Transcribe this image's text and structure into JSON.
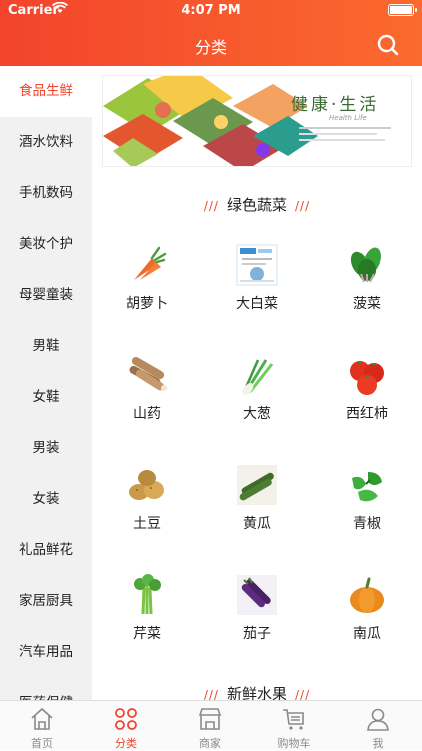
{
  "status_bar": {
    "carrier": "Carrier",
    "time": "4:07 PM"
  },
  "header": {
    "title": "分类",
    "search_icon": "search-icon"
  },
  "colors": {
    "accent": "#f2442c",
    "accent_light": "#fb6a2e",
    "sidebar_bg": "#f1f1f1"
  },
  "sidebar": {
    "items": [
      {
        "label": "食品生鲜",
        "active": true
      },
      {
        "label": "酒水饮料"
      },
      {
        "label": "手机数码"
      },
      {
        "label": "美妆个护"
      },
      {
        "label": "母婴童装"
      },
      {
        "label": "男鞋"
      },
      {
        "label": "女鞋"
      },
      {
        "label": "男装"
      },
      {
        "label": "女装"
      },
      {
        "label": "礼品鲜花"
      },
      {
        "label": "家居厨具"
      },
      {
        "label": "汽车用品"
      },
      {
        "label": "医药保健"
      }
    ]
  },
  "banner": {
    "text": "健康·生活",
    "subtext": "Health Life"
  },
  "sections": [
    {
      "title": "绿色蔬菜",
      "slash": "///",
      "items": [
        {
          "name": "胡萝卜",
          "icon": "carrot-icon"
        },
        {
          "name": "大白菜",
          "icon": "cabbage-icon"
        },
        {
          "name": "菠菜",
          "icon": "spinach-icon"
        },
        {
          "name": "山药",
          "icon": "yam-icon"
        },
        {
          "name": "大葱",
          "icon": "scallion-icon"
        },
        {
          "name": "西红柿",
          "icon": "tomato-icon"
        },
        {
          "name": "土豆",
          "icon": "potato-icon"
        },
        {
          "name": "黄瓜",
          "icon": "cucumber-icon"
        },
        {
          "name": "青椒",
          "icon": "green-pepper-icon"
        },
        {
          "name": "芹菜",
          "icon": "celery-icon"
        },
        {
          "name": "茄子",
          "icon": "eggplant-icon"
        },
        {
          "name": "南瓜",
          "icon": "pumpkin-icon"
        }
      ]
    },
    {
      "title": "新鲜水果",
      "slash": "///"
    }
  ],
  "tabbar": {
    "tabs": [
      {
        "label": "首页",
        "icon": "home-icon"
      },
      {
        "label": "分类",
        "icon": "category-icon",
        "active": true
      },
      {
        "label": "商家",
        "icon": "store-icon"
      },
      {
        "label": "购物车",
        "icon": "cart-icon"
      },
      {
        "label": "我",
        "icon": "user-icon"
      }
    ]
  }
}
